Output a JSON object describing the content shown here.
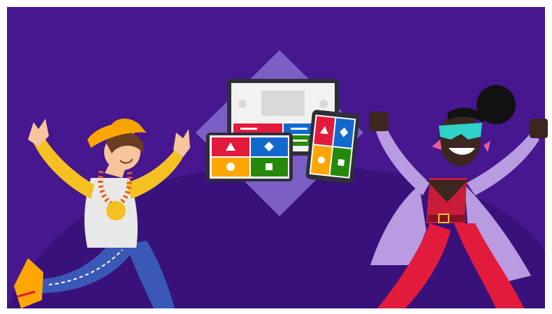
{
  "colors": {
    "page_bg": "#ffffff",
    "background": "#46178f",
    "hill": "#38127a",
    "diamond": "#7b5fc4",
    "red": "#e21b3c",
    "blue": "#1368ce",
    "yellow": "#ffa602",
    "green": "#26890c",
    "device_frame": "#2f2f3a",
    "screen_light": "#f2f2f2"
  },
  "scene": {
    "description_icons": [
      "left-dancer-figure",
      "right-dancer-figure",
      "desktop-monitor-icon",
      "tablet-icon",
      "phone-icon",
      "triangle-icon",
      "diamond-icon",
      "circle-icon",
      "square-icon"
    ]
  }
}
